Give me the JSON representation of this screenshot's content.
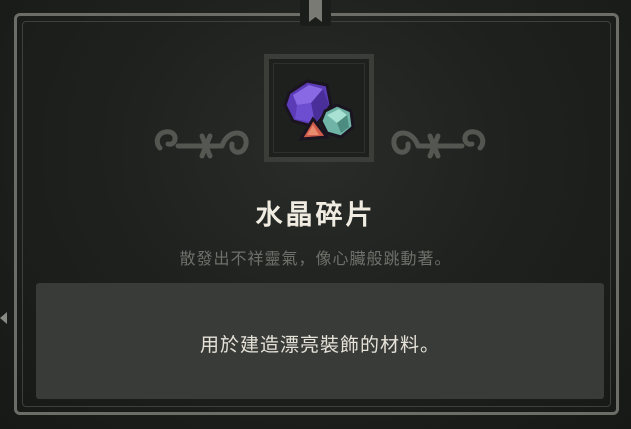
{
  "item": {
    "name": "水晶碎片",
    "flavor_text": "散發出不祥靈氣，像心臟般跳動著。",
    "description": "用於建造漂亮裝飾的材料。",
    "icon": "crystal-shards-icon"
  },
  "colors": {
    "title": "#f0ece2",
    "flavor": "#6e706a",
    "panel": "#393b39",
    "crystal_purple": "#6a48c8",
    "crystal_teal": "#6fb4a6",
    "crystal_red": "#d05a4a"
  }
}
